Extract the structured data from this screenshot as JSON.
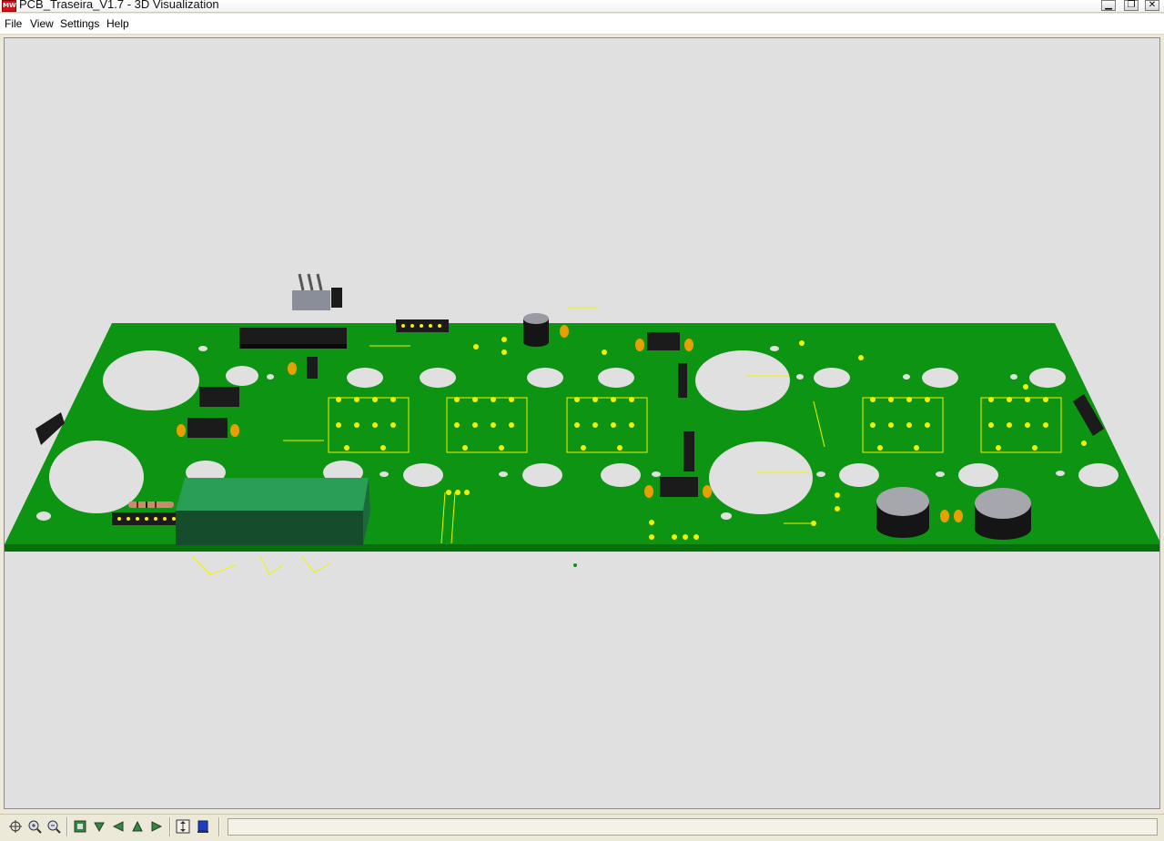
{
  "window": {
    "title": "PCB_Traseira_V1.7 - 3D Visualization",
    "app_icon_text": "MW",
    "controls": [
      "minimize",
      "maximize",
      "close"
    ],
    "minimize_glyph": "▁",
    "maximize_glyph": "❐",
    "close_glyph": "✕"
  },
  "menu": {
    "items": [
      {
        "label": "File"
      },
      {
        "label": "View"
      },
      {
        "label": "Settings"
      },
      {
        "label": "Help"
      }
    ]
  },
  "colors": {
    "board": "#0c9412",
    "board_edge": "#06700b",
    "background": "#e0e0e0",
    "silkscreen": "#f2f200",
    "chip": "#1b1b1b",
    "capacitor_small": "#e8a000",
    "relay": "#1f8a45"
  },
  "toolbar": {
    "icons": [
      "zoom-fit-icon",
      "zoom-in-icon",
      "zoom-out-icon",
      "view-front-icon",
      "view-down-icon",
      "view-left-icon",
      "view-up-icon",
      "view-right-icon",
      "flip-view-icon",
      "component-toggle-icon"
    ],
    "status_text": ""
  }
}
